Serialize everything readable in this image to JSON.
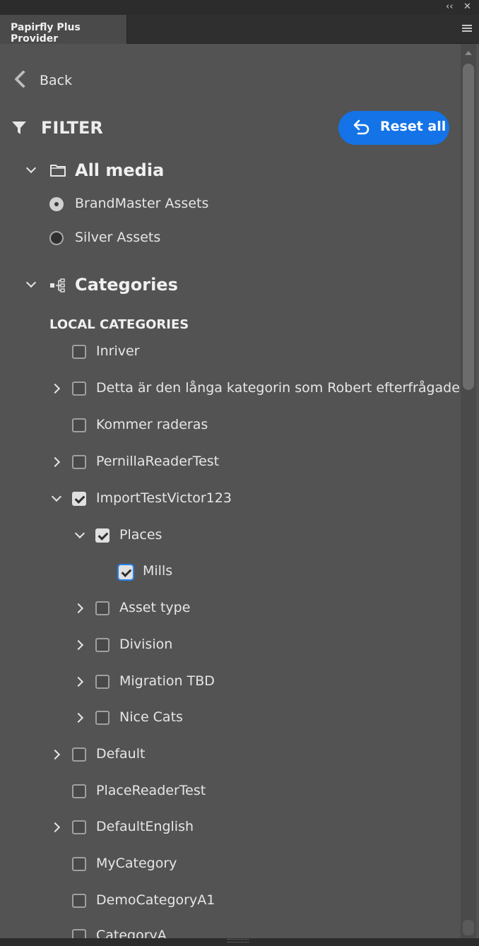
{
  "window": {
    "collapse_glyph": "‹‹",
    "close_glyph": "✕"
  },
  "tab": {
    "title": "Papirfly Plus Provider"
  },
  "nav": {
    "back_label": "Back"
  },
  "filter": {
    "title": "FILTER",
    "reset_label": "Reset all",
    "accent": "#1473e6"
  },
  "media": {
    "title": "All media",
    "options": [
      {
        "label": "BrandMaster Assets",
        "selected": true
      },
      {
        "label": "Silver Assets",
        "selected": false
      }
    ]
  },
  "categories": {
    "title": "Categories",
    "local_heading": "LOCAL CATEGORIES",
    "items": [
      {
        "label": "Inriver",
        "checked": false
      },
      {
        "label": "Detta är den långa kategorin som Robert efterfrågade",
        "checked": false
      },
      {
        "label": "Kommer raderas",
        "checked": false
      },
      {
        "label": "PernillaReaderTest",
        "checked": false
      },
      {
        "label": "ImportTestVictor123",
        "checked": true
      },
      {
        "label": "Places",
        "checked": true
      },
      {
        "label": "Mills",
        "checked": true
      },
      {
        "label": "Asset type",
        "checked": false
      },
      {
        "label": "Division",
        "checked": false
      },
      {
        "label": "Migration TBD",
        "checked": false
      },
      {
        "label": "Nice Cats",
        "checked": false
      },
      {
        "label": "Default",
        "checked": false
      },
      {
        "label": "PlaceReaderTest",
        "checked": false
      },
      {
        "label": "DefaultEnglish",
        "checked": false
      },
      {
        "label": "MyCategory",
        "checked": false
      },
      {
        "label": "DemoCategoryA1",
        "checked": false
      },
      {
        "label": "CategoryA",
        "checked": false
      }
    ]
  }
}
